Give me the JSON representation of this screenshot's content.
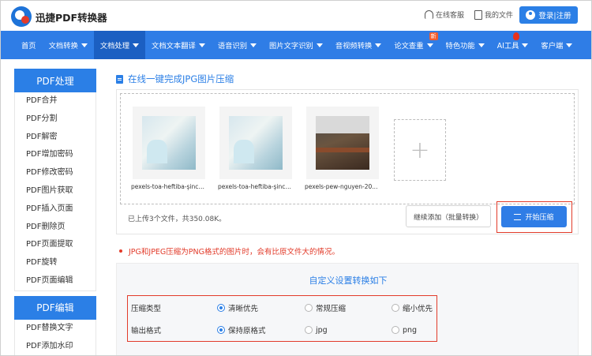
{
  "header": {
    "brand": "迅捷PDF转换器",
    "support_link": "在线客服",
    "my_files_link": "我的文件",
    "login_label": "登录|注册"
  },
  "nav": {
    "items": [
      {
        "label": "首页",
        "caret": false
      },
      {
        "label": "文档转换",
        "caret": true
      },
      {
        "label": "文档处理",
        "caret": true,
        "active": true
      },
      {
        "label": "文档文本翻译",
        "caret": true
      },
      {
        "label": "语音识别",
        "caret": true
      },
      {
        "label": "图片文字识别",
        "caret": true
      },
      {
        "label": "音视频转换",
        "caret": true
      },
      {
        "label": "论文查重",
        "caret": true,
        "badge": "新"
      },
      {
        "label": "特色功能",
        "caret": true
      },
      {
        "label": "AI工具",
        "caret": true,
        "hot": true
      },
      {
        "label": "客户端",
        "caret": true
      }
    ]
  },
  "sidebar": {
    "group1_title": "PDF处理",
    "group1_items": [
      "PDF合并",
      "PDF分割",
      "PDF解密",
      "PDF增加密码",
      "PDF修改密码",
      "PDF图片获取",
      "PDF插入页面",
      "PDF删除页",
      "PDF页面提取",
      "PDF旋转",
      "PDF页面编辑"
    ],
    "group2_title": "PDF编辑",
    "group2_items": [
      "PDF替换文字",
      "PDF添加水印"
    ]
  },
  "main": {
    "title": "在线一键完成JPG图片压缩",
    "files": [
      {
        "name": "pexels-toa-heftiba-şinca..."
      },
      {
        "name": "pexels-toa-heftiba-şinca..."
      },
      {
        "name": "pexels-pew-nguyen-20..."
      }
    ],
    "add_symbol": "+",
    "upload_status": "已上传3个文件，共350.08K。",
    "continue_button": "继续添加（批量转换）",
    "start_button": "开始压缩",
    "notice": "JPG和JPEG压缩为PNG格式的图片时，会有比原文件大的情况。"
  },
  "settings": {
    "title": "自定义设置转换如下",
    "compress_type": {
      "label": "压缩类型",
      "options": [
        "清晰优先",
        "常规压缩",
        "缩小优先"
      ],
      "selected": "清晰优先"
    },
    "output_format": {
      "label": "输出格式",
      "options": [
        "保持原格式",
        "jpg",
        "png"
      ],
      "selected": "保持原格式"
    }
  },
  "colors": {
    "accent": "#2f7de6",
    "nav_active": "#1b5fc2",
    "highlight_red": "#e23b2a"
  }
}
